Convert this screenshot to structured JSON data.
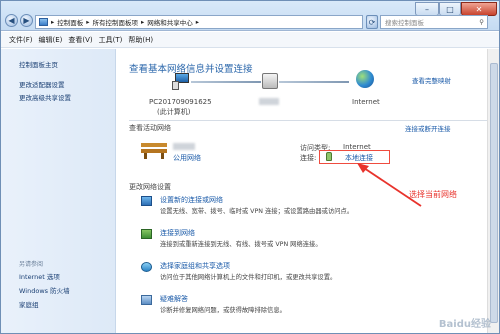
{
  "breadcrumb": [
    "控制面板",
    "所有控制面板项",
    "网络和共享中心"
  ],
  "search_placeholder": "搜索控制面板",
  "menu": [
    "文件(F)",
    "编辑(E)",
    "查看(V)",
    "工具(T)",
    "帮助(H)"
  ],
  "sidebar": {
    "home": "控制面板主页",
    "items": [
      "更改适配器设置",
      "更改高级共享设置"
    ],
    "see_also": "另请参阅",
    "footer": [
      "Internet 选项",
      "Windows 防火墙",
      "家庭组"
    ]
  },
  "main": {
    "title": "查看基本网络信息并设置连接",
    "full_map": "查看完整映射",
    "pc_name": "PC201709091625",
    "pc_sub": "(此计算机)",
    "internet": "Internet",
    "active_title": "查看活动网络",
    "connect_link": "连接或断开连接",
    "network_type": "公用网络",
    "access_type_label": "访问类型:",
    "access_type_value": "Internet",
    "connection_label": "连接:",
    "connection_value": "本地连接",
    "annotation": "选择当前网络",
    "change_title": "更改网络设置",
    "tasks": [
      {
        "title": "设置新的连接或网络",
        "desc": "设置无线、宽带、拨号、临时或 VPN 连接；或设置路由器或访问点。"
      },
      {
        "title": "连接到网络",
        "desc": "连接到或重新连接到无线、有线、拨号或 VPN 网络连接。"
      },
      {
        "title": "选择家庭组和共享选项",
        "desc": "访问位于其他网络计算机上的文件和打印机，或更改共享设置。"
      },
      {
        "title": "疑难解答",
        "desc": "诊断并修复网络问题，或获得故障排除信息。"
      }
    ]
  },
  "watermark": "Baidu经验"
}
